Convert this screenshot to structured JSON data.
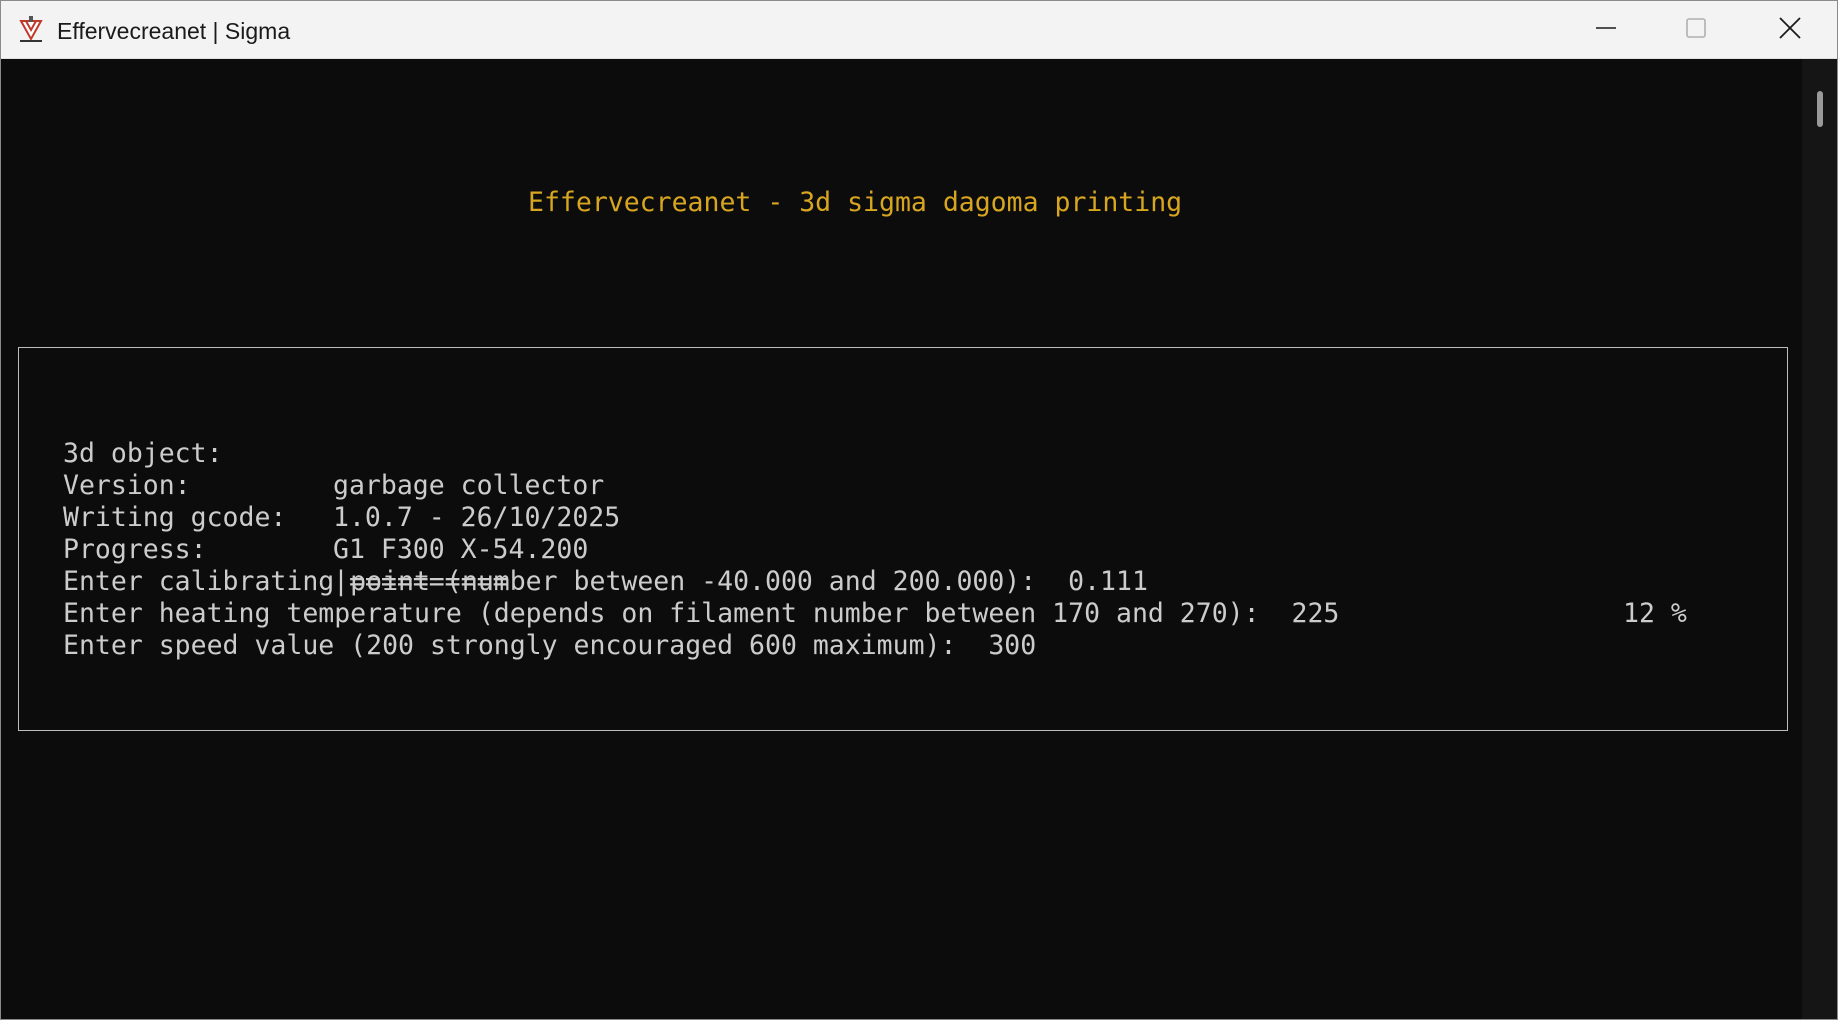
{
  "window": {
    "title": "Effervecreanet | Sigma",
    "icon": "sigma-app-icon",
    "controls": [
      "minimize-icon",
      "maximize-icon",
      "close-icon"
    ]
  },
  "terminal": {
    "header": "Effervecreanet - 3d sigma dagoma printing",
    "header_color": "#d7a520",
    "info": [
      {
        "label": "3d object:",
        "value": "garbage collector"
      },
      {
        "label": "Version:",
        "value": "1.0.7 - 26/10/2025"
      },
      {
        "label": "Writing gcode:",
        "value": "G1 F300 X-54.200"
      },
      {
        "label": "Progress:",
        "value": "|=========="
      }
    ],
    "progress_percent_text": "12 %",
    "progress_value": 12,
    "prompts": [
      "Enter calibrating point (number between -40.000 and 200.000):  0.111",
      "Enter heating temperature (depends on filament number between 170 and 270):  225",
      "Enter speed value (200 strongly encouraged 600 maximum):  300"
    ]
  }
}
